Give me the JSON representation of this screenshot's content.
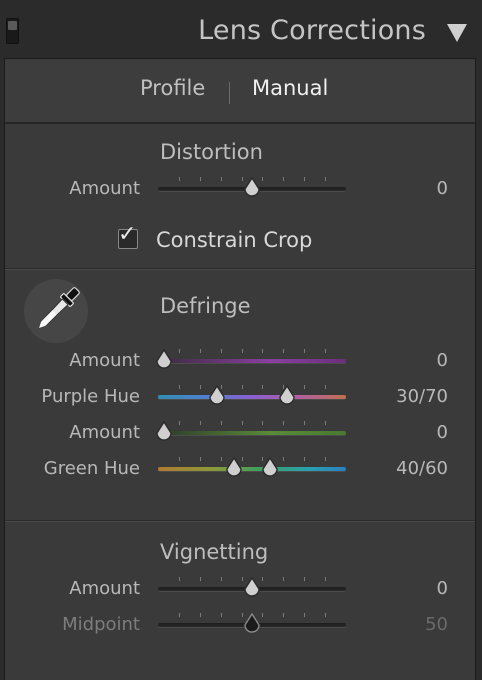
{
  "header": {
    "title": "Lens Corrections"
  },
  "tabs": {
    "profile": "Profile",
    "manual": "Manual",
    "active": "Manual"
  },
  "distortion": {
    "title": "Distortion",
    "amount": {
      "label": "Amount",
      "value": "0",
      "position": 0.5
    },
    "constrain_crop": {
      "label": "Constrain Crop",
      "checked": true
    }
  },
  "defringe": {
    "title": "Defringe",
    "purple_amount": {
      "label": "Amount",
      "value": "0",
      "position": 0.0
    },
    "purple_hue": {
      "label": "Purple Hue",
      "value": "30/70",
      "positions": [
        0.3,
        0.7
      ]
    },
    "green_amount": {
      "label": "Amount",
      "value": "0",
      "position": 0.0
    },
    "green_hue": {
      "label": "Green Hue",
      "value": "40/60",
      "positions": [
        0.4,
        0.6
      ]
    }
  },
  "vignetting": {
    "title": "Vignetting",
    "amount": {
      "label": "Amount",
      "value": "0",
      "position": 0.5
    },
    "midpoint": {
      "label": "Midpoint",
      "value": "50",
      "position": 0.5
    }
  },
  "colors": {
    "panel_bg": "#3a3a3a",
    "header_bg": "#2b2b2b",
    "purple_track": "#8a3fa0",
    "green_track": "#5a8a3a"
  }
}
